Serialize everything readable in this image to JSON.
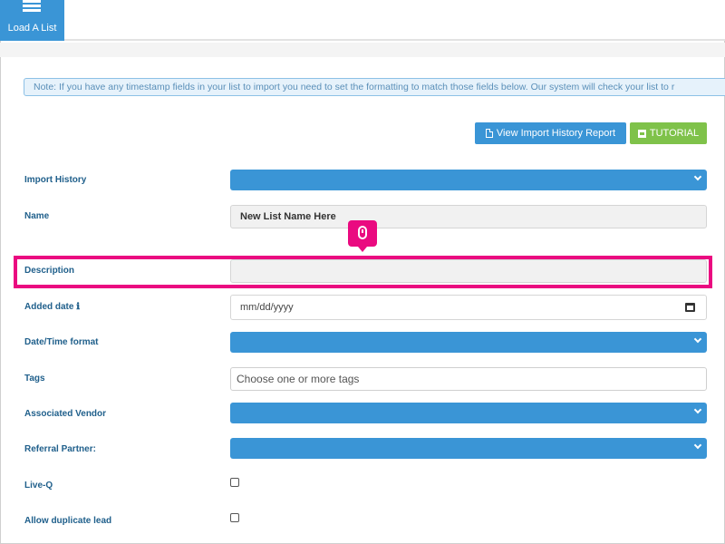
{
  "topbar": {
    "tab_label": "Load A List",
    "tab_icon": "list-icon"
  },
  "note": "Note: If you have any timestamp fields in your list to import you need to set the formatting to match those fields below. Our system will check your list to r",
  "buttons": {
    "history_label": "View Import History Report",
    "tutorial_label": "TUTORIAL"
  },
  "form": {
    "import_history_label": "Import History",
    "name_label": "Name",
    "name_value": "New List Name Here",
    "description_label": "Description",
    "description_value": "",
    "added_date_label": "Added date ℹ",
    "added_date_placeholder": "mm/dd/yyyy",
    "datetime_format_label": "Date/Time format",
    "tags_label": "Tags",
    "tags_placeholder": "Choose one or more tags",
    "vendor_label": "Associated Vendor",
    "referral_label": "Referral Partner:",
    "liveq_label": "Live-Q",
    "duplicate_label": "Allow duplicate lead"
  },
  "colors": {
    "primary": "#3a95d6",
    "success": "#7fc24a",
    "highlight": "#ea0a80",
    "label": "#1f5f8b"
  }
}
